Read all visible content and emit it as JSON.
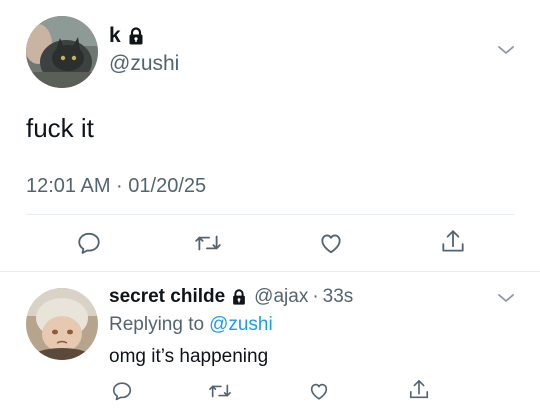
{
  "tweet": {
    "author": {
      "name": "k",
      "handle": "@zushi",
      "protected": true
    },
    "text": "fuck it",
    "timestamp": "12:01 AM · 01/20/25",
    "actions": [
      "reply-icon",
      "retweet-icon",
      "like-icon",
      "share-icon"
    ]
  },
  "reply": {
    "author": {
      "name": "secret childe",
      "handle": "@ajax",
      "protected": true
    },
    "dot": "·",
    "time": "33s",
    "replying_label": "Replying to",
    "replying_to": "@zushi",
    "text": "omg it’s happening",
    "actions": [
      "reply-icon",
      "retweet-icon",
      "like-icon",
      "share-icon"
    ]
  },
  "colors": {
    "text": "#0f1419",
    "secondary": "#536471",
    "link": "#1d9bf0",
    "divider": "#e6ecf0"
  }
}
